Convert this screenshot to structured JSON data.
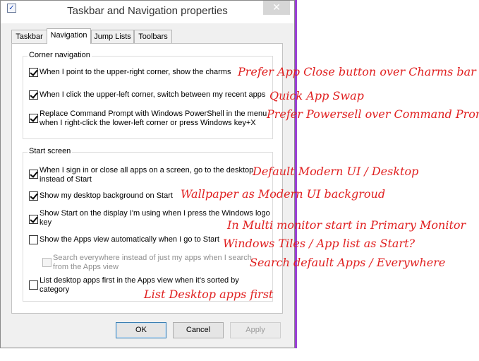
{
  "window": {
    "title": "Taskbar and Navigation properties",
    "close_icon": "close-icon",
    "accent_color": "#9a3fd6"
  },
  "tabs": [
    {
      "label": "Taskbar",
      "active": false
    },
    {
      "label": "Navigation",
      "active": true
    },
    {
      "label": "Jump Lists",
      "active": false
    },
    {
      "label": "Toolbars",
      "active": false
    }
  ],
  "corner_navigation": {
    "heading": "Corner navigation",
    "options": [
      {
        "label": "When I point to the upper-right corner, show the charms",
        "checked": true
      },
      {
        "label": "When I click the upper-left corner, switch between my recent apps",
        "checked": true
      },
      {
        "label_line1": "Replace Command Prompt with Windows PowerShell in the menu",
        "label_line2": "when I right-click the lower-left corner or press Windows key+X",
        "checked": true
      }
    ]
  },
  "start_screen": {
    "heading": "Start screen",
    "options": [
      {
        "label_line1": "When I sign in or close all apps on a screen, go to the desktop",
        "label_line2": "instead of Start",
        "checked": true
      },
      {
        "label": "Show my desktop background on Start",
        "checked": true
      },
      {
        "label_line1": "Show Start on the display I'm using when I press the Windows logo",
        "label_line2": "key",
        "checked": true
      },
      {
        "label": "Show the Apps view automatically when I go to Start",
        "checked": false
      },
      {
        "label_line1": "Search everywhere instead of just my apps when I search",
        "label_line2": "from the Apps view",
        "checked": false,
        "disabled": true
      },
      {
        "label_line1": "List desktop apps first in the Apps view when it's sorted by",
        "label_line2": "category",
        "checked": false
      }
    ]
  },
  "buttons": {
    "ok": "OK",
    "cancel": "Cancel",
    "apply": "Apply"
  },
  "annotations": [
    "Prefer App Close button over Charms bar",
    "Quick App Swap",
    "Prefer Powersell over Command Prompt",
    "Default Modern UI / Desktop",
    "Wallpaper as Modern UI backgroud",
    "In Multi monitor start in Primary Monitor",
    "Windows Tiles / App list as Start?",
    "Search default Apps / Everywhere",
    "List Desktop apps first"
  ],
  "annotation_color": "#e02020"
}
